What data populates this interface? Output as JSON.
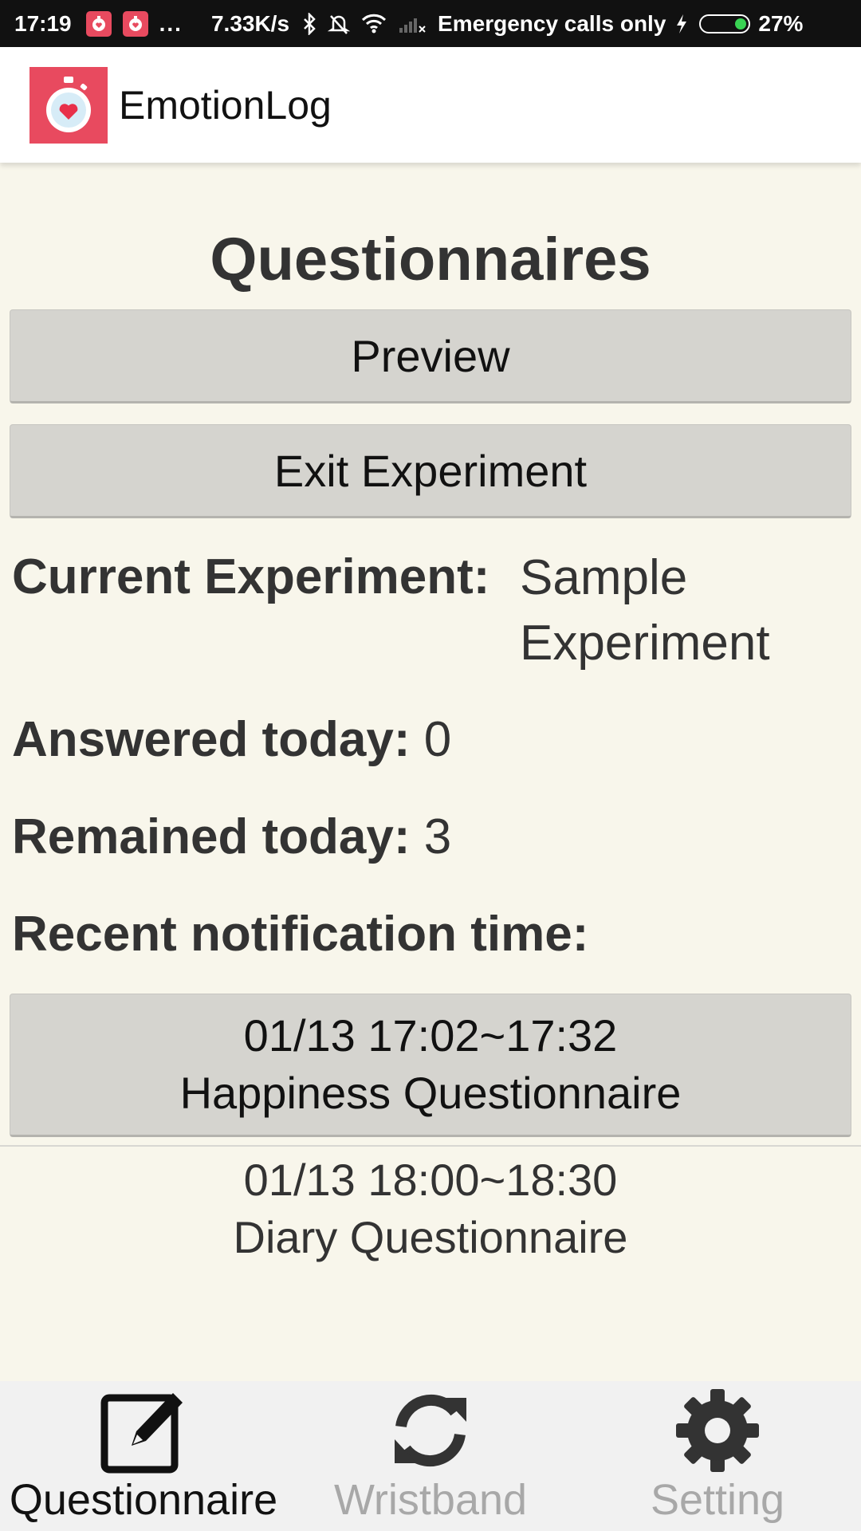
{
  "status_bar": {
    "time": "17:19",
    "notification_icons": [
      "stopwatch-icon",
      "stopwatch-icon"
    ],
    "more": "...",
    "net_speed": "7.33K/s",
    "carrier": "Emergency calls only",
    "battery": "27%",
    "battery_level": 0.27
  },
  "app_bar": {
    "title": "EmotionLog",
    "logo_icon": "stopwatch-heart-icon",
    "logo_color": "#e84a5f"
  },
  "main": {
    "heading": "Questionnaires",
    "preview_label": "Preview",
    "exit_label": "Exit Experiment",
    "current_experiment_label": "Current Experiment:",
    "current_experiment_value_line1": "Sample",
    "current_experiment_value_line2": "Experiment",
    "answered_label": "Answered today:",
    "answered_value": "0",
    "remained_label": "Remained today:",
    "remained_value": "3",
    "recent_label": "Recent notification time:",
    "notifications": [
      {
        "time": "01/13 17:02~17:32",
        "name": "Happiness Questionnaire",
        "active": true
      },
      {
        "time": "01/13 18:00~18:30",
        "name": "Diary Questionnaire",
        "active": false
      }
    ]
  },
  "bottom_nav": {
    "tabs": [
      {
        "label": "Questionnaire",
        "icon": "edit-icon",
        "active": true
      },
      {
        "label": "Wristband",
        "icon": "sync-icon",
        "active": false
      },
      {
        "label": "Setting",
        "icon": "gear-icon",
        "active": false
      }
    ]
  }
}
